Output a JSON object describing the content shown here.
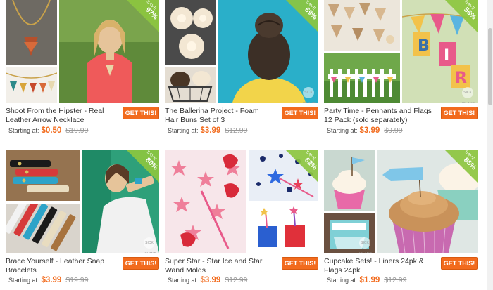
{
  "accent": "#f26b1d",
  "save_color": "#8cc63f",
  "starting_label": "Starting at:",
  "button_label": "GET THIS!",
  "save_label": "SAVE",
  "watermark": "SICK ISLAND",
  "products": [
    {
      "title": "Shoot From the Hipster - Real Leather Arrow Necklace",
      "price": "$0.50",
      "original": "$19.99",
      "save_pct": "97%"
    },
    {
      "title": "The Ballerina Project - Foam Hair Buns Set of 3",
      "price": "$3.99",
      "original": "$12.99",
      "save_pct": "69%"
    },
    {
      "title": "Party Time - Pennants and Flags 12 Pack (sold separately)",
      "price": "$3.99",
      "original": "$9.99",
      "save_pct": "56%"
    },
    {
      "title": "Brace Yourself - Leather Snap Bracelets",
      "price": "$3.99",
      "original": "$19.99",
      "save_pct": "80%"
    },
    {
      "title": "Super Star - Star Ice and Star Wand Molds",
      "price": "$3.99",
      "original": "$12.99",
      "save_pct": "62%"
    },
    {
      "title": "Cupcake Sets! - Liners 24pk & Flags 24pk",
      "price": "$1.99",
      "original": "$12.99",
      "save_pct": "85%"
    }
  ]
}
